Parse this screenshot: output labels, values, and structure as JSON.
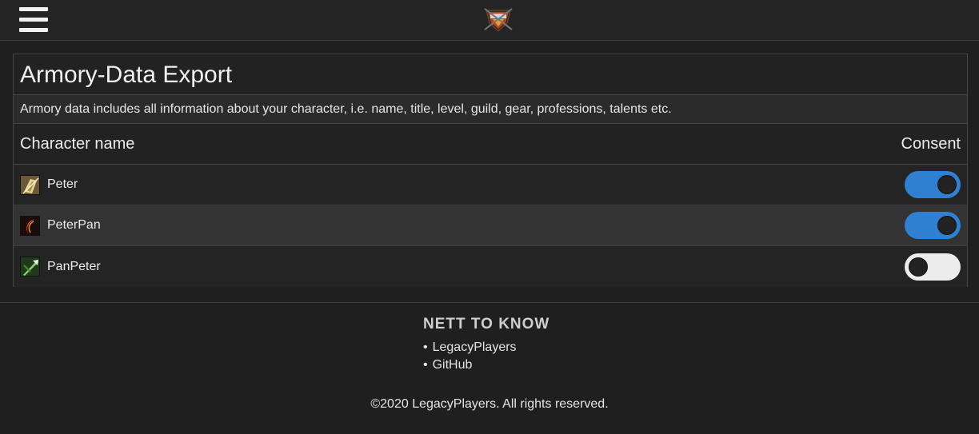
{
  "header": {
    "menu_icon": "hamburger-menu-icon",
    "logo_icon": "site-logo-icon"
  },
  "panel": {
    "title": "Armory-Data Export",
    "description": "Armory data includes all information about your character, i.e. name, title, level, guild, gear, professions, talents etc.",
    "column_name": "Character name",
    "column_consent": "Consent",
    "characters": [
      {
        "name": "Peter",
        "class_icon": "paladin-class-icon",
        "consent": true
      },
      {
        "name": "PeterPan",
        "class_icon": "warlock-class-icon",
        "consent": true
      },
      {
        "name": "PanPeter",
        "class_icon": "hunter-class-icon",
        "consent": false
      }
    ]
  },
  "footer": {
    "heading": "NETT TO KNOW",
    "links": [
      "LegacyPlayers",
      "GitHub"
    ],
    "copyright": "©2020 LegacyPlayers. All rights reserved."
  },
  "colors": {
    "toggle_on": "#2f80d1",
    "toggle_off": "#ececec",
    "background": "#1f1f1f"
  }
}
